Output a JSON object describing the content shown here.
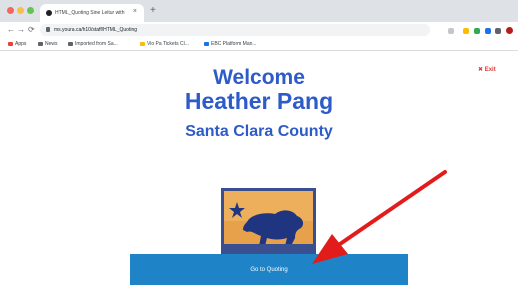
{
  "browser": {
    "tab_title": "HTML_Quoting Sine Leitur with",
    "tab_close": "×",
    "new_tab": "+",
    "address": "ms.youra.ca/h10/staff/HTML_Quoting",
    "nav": {
      "back": "←",
      "forward": "→",
      "reload": "⟳"
    },
    "bookmarks": [
      {
        "label": "Apps"
      },
      {
        "label": "News"
      },
      {
        "label": "Imported from Sa..."
      },
      {
        "label": "Vio Pa Tickets Cl..."
      },
      {
        "label": "EBC Platform Man..."
      }
    ]
  },
  "page": {
    "welcome": "Welcome",
    "name": "Heather Pang",
    "county": "Santa Clara County",
    "exit_label": "✖ Exit",
    "go_button": "Go to Quoting"
  },
  "colors": {
    "title": "#2d5bc8",
    "button": "#1e83c7",
    "arrow": "#e21b1b",
    "exit": "#e53935"
  }
}
